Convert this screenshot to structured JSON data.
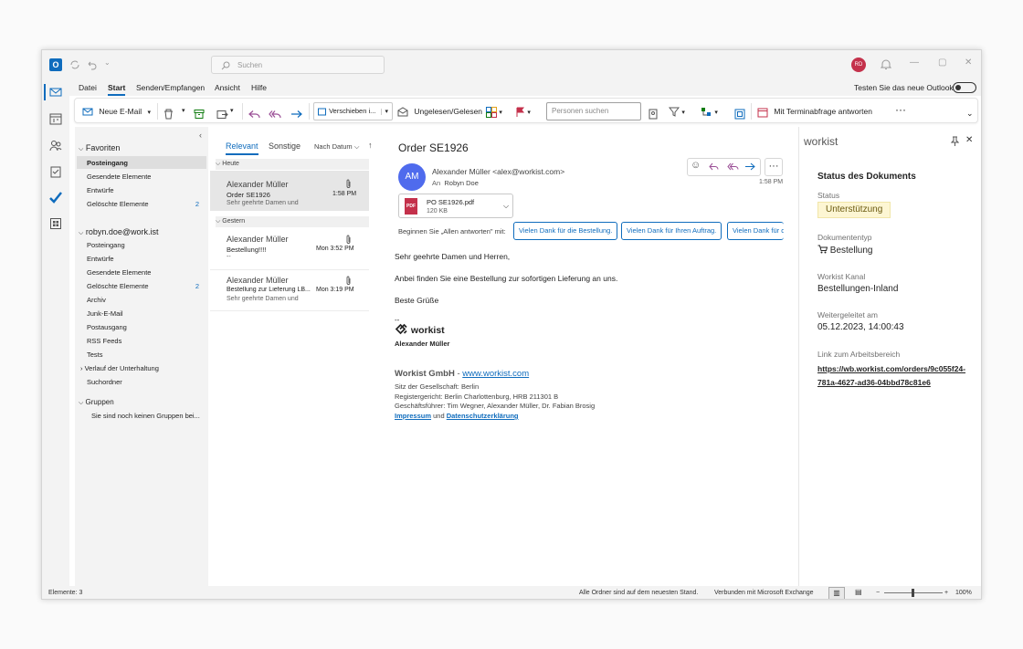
{
  "titlebar": {
    "search_placeholder": "Suchen",
    "avatar_initials": "RD"
  },
  "menu": {
    "items": [
      "Datei",
      "Start",
      "Senden/Empfangen",
      "Ansicht",
      "Hilfe"
    ],
    "try_new": "Testen Sie das neue Outlook"
  },
  "ribbon": {
    "new_mail": "Neue E-Mail",
    "move": "Verschieben i...",
    "unread_read": "Ungelesen/Gelesen",
    "people_search_placeholder": "Personen suchen",
    "meeting_reply": "Mit Terminabfrage antworten"
  },
  "folders": {
    "favorites_header": "Favoriten",
    "favorites": [
      {
        "label": "Posteingang",
        "selected": true
      },
      {
        "label": "Gesendete Elemente"
      },
      {
        "label": "Entwürfe"
      },
      {
        "label": "Gelöschte Elemente",
        "count": "2"
      }
    ],
    "account": "robyn.doe@work.ist",
    "account_folders": [
      {
        "label": "Posteingang"
      },
      {
        "label": "Entwürfe"
      },
      {
        "label": "Gesendete Elemente"
      },
      {
        "label": "Gelöschte Elemente",
        "count": "2"
      },
      {
        "label": "Archiv"
      },
      {
        "label": "Junk-E-Mail"
      },
      {
        "label": "Postausgang"
      },
      {
        "label": "RSS Feeds"
      },
      {
        "label": "Tests"
      },
      {
        "label": "Verlauf der Unterhaltung"
      },
      {
        "label": "Suchordner"
      }
    ],
    "groups_header": "Gruppen",
    "groups_note": "Sie sind noch keinen Gruppen bei..."
  },
  "list": {
    "tabs": [
      "Relevant",
      "Sonstige"
    ],
    "sort": "Nach Datum",
    "group_today": "Heute",
    "group_yesterday": "Gestern",
    "messages": [
      {
        "from": "Alexander Müller",
        "subject": "Order SE1926",
        "time": "1:58 PM",
        "preview": "Sehr geehrte Damen und"
      },
      {
        "from": "Alexander Müller",
        "subject": "Bestellung!!!!",
        "time": "Mon 3:52 PM",
        "preview": "--"
      },
      {
        "from": "Alexander Müller",
        "subject": "Bestellung zur Lieferung LB...",
        "time": "Mon 3:19 PM",
        "preview": "Sehr geehrte Damen und"
      }
    ]
  },
  "reading": {
    "subject": "Order SE1926",
    "avatar": "AM",
    "sender": "Alexander Müller <alex@workist.com>",
    "to_label": "An",
    "to": "Robyn Doe",
    "time": "1:58 PM",
    "attachment_name": "PO SE1926.pdf",
    "attachment_size": "120 KB",
    "reply_all_prompt": "Beginnen Sie „Allen antworten\" mit:",
    "suggestions": [
      "Vielen Dank für die Bestellung.",
      "Vielen Dank für Ihren Auftrag.",
      "Vielen Dank für d"
    ],
    "body": [
      "Sehr geehrte Damen und Herren,",
      "Anbei finden Sie eine Bestellung zur sofortigen Lieferung an uns.",
      "Beste Grüße"
    ],
    "sig_dashes": "--",
    "sig_logo": "workist",
    "sig_name": "Alexander Müller",
    "company": "Workist GmbH",
    "company_sep": " - ",
    "company_link": "www.workist.com",
    "sig_lines": [
      "Sitz der Gesellschaft: Berlin",
      "Registergericht: Berlin Charlottenburg, HRB 211301 B",
      "Geschäftsführer: Tim Wegner, Alexander Müller, Dr. Fabian Brosig"
    ],
    "impressum": "Impressum",
    "und": " und ",
    "datenschutz": "Datenschutzerklärung"
  },
  "workist": {
    "panel_title": "workist",
    "section_title": "Status des Dokuments",
    "status_label": "Status",
    "status_value": "Unterstützung",
    "doctype_label": "Dokumententyp",
    "doctype_value": "Bestellung",
    "channel_label": "Workist Kanal",
    "channel_value": "Bestellungen-Inland",
    "forwarded_label": "Weitergeleitet am",
    "forwarded_value": "05.12.2023, 14:00:43",
    "link_label": "Link zum Arbeitsbereich",
    "link_line1": "https://wb.workist.com/orders/9c055f24-",
    "link_line2": "781a-4627-ad36-04bbd78c81e6"
  },
  "status": {
    "items_count": "Elemente: 3",
    "folders_status": "Alle Ordner sind auf dem neuesten Stand.",
    "connection": "Verbunden mit Microsoft Exchange",
    "zoom": "100%"
  },
  "colors": {
    "accent": "#0f6cbd",
    "status_badge_bg": "#fdf6d3",
    "avatar_bg": "#4f6bed"
  }
}
